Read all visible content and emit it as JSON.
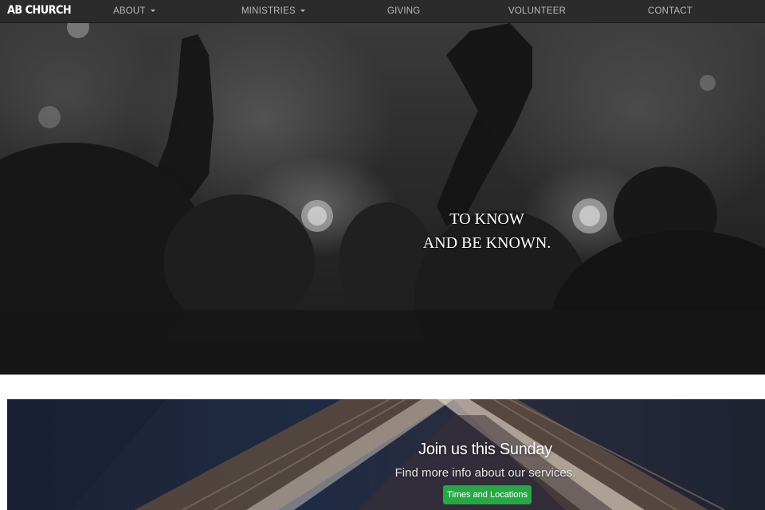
{
  "navbar": {
    "brand": "AB CHURCH",
    "items": [
      {
        "label": "ABOUT",
        "dropdown": true
      },
      {
        "label": "MINISTRIES",
        "dropdown": true
      },
      {
        "label": "GIVING",
        "dropdown": false
      },
      {
        "label": "VOLUNTEER",
        "dropdown": false
      },
      {
        "label": "CONTACT",
        "dropdown": false
      }
    ]
  },
  "hero": {
    "line1": "TO KNOW",
    "line2": "AND BE KNOWN."
  },
  "sunday": {
    "title": "Join us this Sunday",
    "subtitle": "Find more info about our services.",
    "button_label": "Times and Locations"
  },
  "colors": {
    "nav_bg": "#2b2b2b",
    "nav_text": "#b9b9b9",
    "button_green": "#28a745"
  }
}
